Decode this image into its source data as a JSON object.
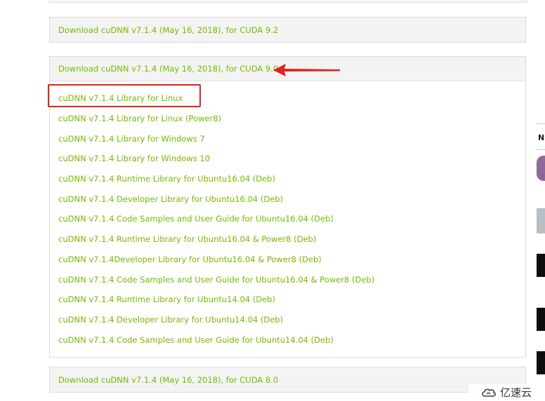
{
  "panels": {
    "cuda92": {
      "header": "Download cuDNN v7.1.4 (May 16, 2018), for CUDA 9.2"
    },
    "cuda90": {
      "header": "Download cuDNN v7.1.4 (May 16, 2018), for CUDA 9.0",
      "links": [
        "cuDNN v7.1.4 Library for Linux",
        "cuDNN v7.1.4 Library for Linux (Power8)",
        "cuDNN v7.1.4 Library for Windows 7",
        "cuDNN v7.1.4 Library for Windows 10",
        "cuDNN v7.1.4 Runtime Library for Ubuntu16.04 (Deb)",
        "cuDNN v7.1.4 Developer Library for Ubuntu16.04 (Deb)",
        "cuDNN v7.1.4 Code Samples and User Guide for Ubuntu16.04 (Deb)",
        "cuDNN v7.1.4 Runtime Library for Ubuntu16.04 & Power8 (Deb)",
        "cuDNN v7.1.4Developer Library for Ubuntu16.04 & Power8 (Deb)",
        "cuDNN v7.1.4 Code Samples and User Guide for Ubuntu16.04 & Power8 (Deb)",
        "cuDNN v7.1.4 Runtime Library for Ubuntu14.04 (Deb)",
        "cuDNN v7.1.4 Developer Library for Ubuntu14.04 (Deb)",
        "cuDNN v7.1.4 Code Samples and User Guide for Ubuntu14.04 (Deb)"
      ]
    },
    "cuda80": {
      "header": "Download cuDNN v7.1.4 (May 16, 2018), for CUDA 8.0"
    }
  },
  "sidebar": {
    "letter": "N"
  },
  "watermark": {
    "text": "亿速云",
    "icon": "cloud-logo-icon"
  },
  "colors": {
    "link": "#76b900",
    "annotation": "#e0241b",
    "panel_header_bg": "#f3f3f3",
    "border": "#dcdcdc"
  }
}
